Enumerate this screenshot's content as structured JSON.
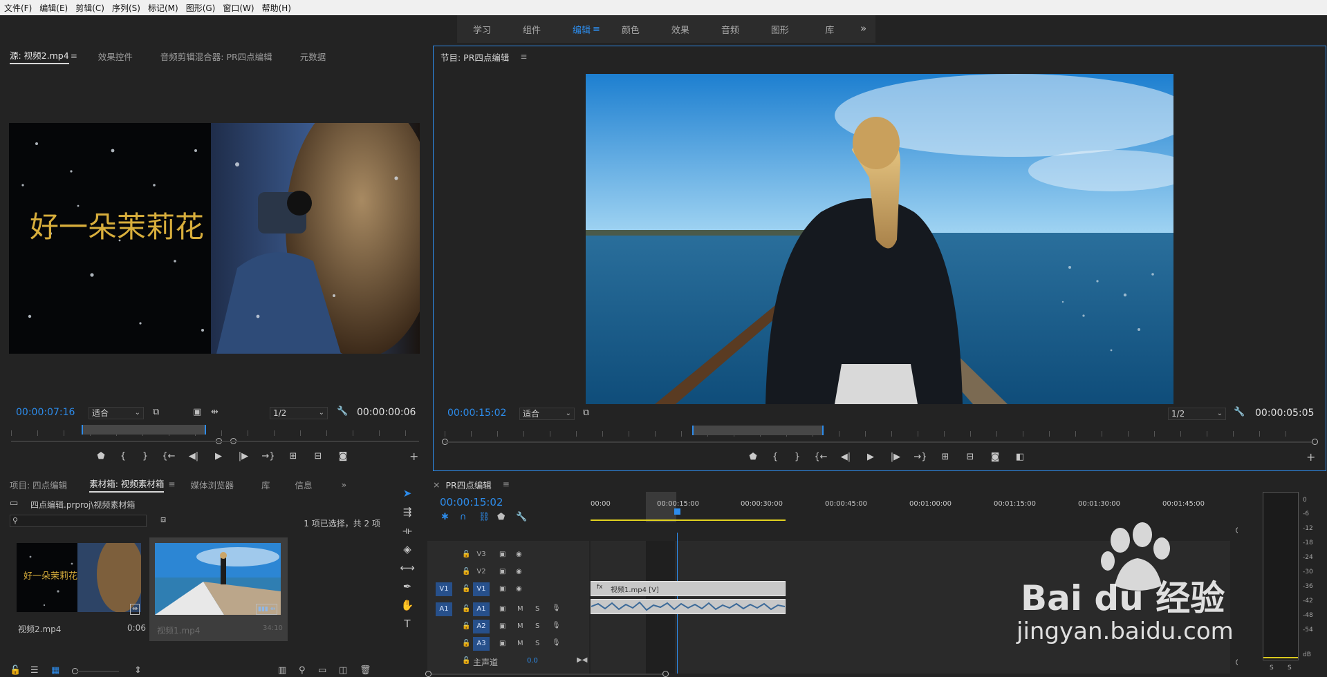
{
  "menubar": {
    "items": [
      "文件(F)",
      "编辑(E)",
      "剪辑(C)",
      "序列(S)",
      "标记(M)",
      "图形(G)",
      "窗口(W)",
      "帮助(H)"
    ]
  },
  "workspace": {
    "tabs": [
      "学习",
      "组件",
      "编辑",
      "颜色",
      "效果",
      "音频",
      "图形",
      "库"
    ],
    "active": "编辑",
    "more_glyph": "»"
  },
  "source": {
    "tabs": [
      "源: 视频2.mp4",
      "效果控件",
      "音频剪辑混合器: PR四点编辑",
      "元数据"
    ],
    "title_text": "好一朵茉莉花",
    "timecode": "00:00:07:16",
    "fit": "适合",
    "resolution": "1/2",
    "duration": "00:00:00:06"
  },
  "program": {
    "tab": "节目: PR四点编辑",
    "timecode": "00:00:15:02",
    "fit": "适合",
    "resolution": "1/2",
    "duration": "00:00:05:05"
  },
  "project": {
    "tabs": [
      "项目: 四点编辑",
      "素材箱: 视频素材箱",
      "媒体浏览器",
      "库",
      "信息"
    ],
    "path": "四点编辑.prproj\\视频素材箱",
    "selection": "1 项已选择，共 2 项",
    "items": [
      {
        "name": "视频2.mp4",
        "duration": "0:06",
        "thumb_text": "好一朵茉莉花"
      },
      {
        "name": "视频1.mp4",
        "duration": "34:10"
      }
    ]
  },
  "timeline": {
    "tab": "PR四点编辑",
    "timecode": "00:00:15:02",
    "ruler": [
      "00:00",
      "00:00:15:00",
      "00:00:30:00",
      "00:00:45:00",
      "00:01:00:00",
      "00:01:15:00",
      "00:01:30:00",
      "00:01:45:00"
    ],
    "video_tracks": [
      "V3",
      "V2",
      "V1"
    ],
    "audio_tracks": [
      "A1",
      "A2",
      "A3"
    ],
    "master": "主声道",
    "master_value": "0.0",
    "clip_video_label": "视频1.mp4 [V]",
    "track_m": "M",
    "track_s": "S"
  },
  "meter": {
    "db": [
      "0",
      "-6",
      "-12",
      "-18",
      "-24",
      "-30",
      "-36",
      "-42",
      "-48",
      "-54",
      "dB"
    ],
    "solo": [
      "S",
      "S"
    ]
  },
  "watermark": {
    "brand": "Bai du 经验",
    "url": "jingyan.baidu.com"
  },
  "colors": {
    "accent": "#2d8ceb",
    "panel": "#232323"
  }
}
